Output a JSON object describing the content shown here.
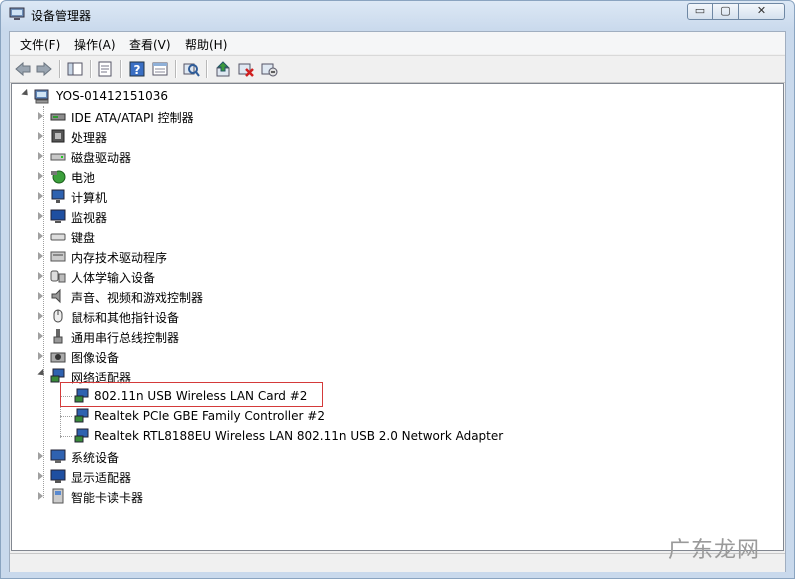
{
  "window": {
    "title": "设备管理器",
    "min_glyph": "▭",
    "max_glyph": "▢",
    "close_glyph": "✕"
  },
  "menu": [
    {
      "label": "文件(F)"
    },
    {
      "label": "操作(A)"
    },
    {
      "label": "查看(V)"
    },
    {
      "label": "帮助(H)"
    }
  ],
  "toolbar": {
    "buttons": [
      {
        "icon": "back-arrow-icon"
      },
      {
        "icon": "forward-arrow-icon"
      },
      {
        "icon": "show-hide-tree-icon"
      },
      {
        "icon": "properties-icon"
      },
      {
        "icon": "help-icon"
      },
      {
        "icon": "view-icon"
      },
      {
        "icon": "scan-hardware-icon"
      },
      {
        "icon": "update-driver-icon"
      },
      {
        "icon": "disable-device-icon"
      },
      {
        "icon": "uninstall-device-icon"
      }
    ]
  },
  "tree": {
    "root": "YOS-01412151036",
    "categories": [
      {
        "label": "IDE ATA/ATAPI 控制器",
        "icon": "ide-controller-icon"
      },
      {
        "label": "处理器",
        "icon": "processor-icon"
      },
      {
        "label": "磁盘驱动器",
        "icon": "disk-drive-icon"
      },
      {
        "label": "电池",
        "icon": "battery-icon"
      },
      {
        "label": "计算机",
        "icon": "computer-icon"
      },
      {
        "label": "监视器",
        "icon": "monitor-icon"
      },
      {
        "label": "键盘",
        "icon": "keyboard-icon"
      },
      {
        "label": "内存技术驱动程序",
        "icon": "memory-driver-icon"
      },
      {
        "label": "人体学输入设备",
        "icon": "hid-icon"
      },
      {
        "label": "声音、视频和游戏控制器",
        "icon": "sound-icon"
      },
      {
        "label": "鼠标和其他指针设备",
        "icon": "mouse-icon"
      },
      {
        "label": "通用串行总线控制器",
        "icon": "usb-icon"
      },
      {
        "label": "图像设备",
        "icon": "camera-icon"
      },
      {
        "label": "网络适配器",
        "icon": "network-adapter-icon",
        "expanded": true,
        "children": [
          {
            "label": "802.11n USB Wireless LAN Card #2",
            "highlighted": true
          },
          {
            "label": "Realtek PCIe GBE Family Controller #2"
          },
          {
            "label": "Realtek RTL8188EU Wireless LAN 802.11n USB 2.0 Network Adapter"
          }
        ]
      },
      {
        "label": "系统设备",
        "icon": "system-device-icon"
      },
      {
        "label": "显示适配器",
        "icon": "display-adapter-icon"
      },
      {
        "label": "智能卡读卡器",
        "icon": "smart-card-reader-icon"
      }
    ]
  },
  "watermark": "广东龙网",
  "colors": {
    "highlight_box": "#d43a3a",
    "title_gradient_top": "#dce8f5",
    "title_gradient_bottom": "#c9d9ec"
  }
}
